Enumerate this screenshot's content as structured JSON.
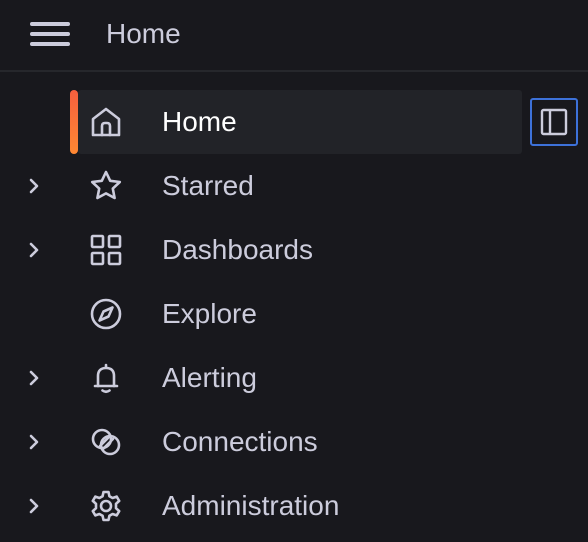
{
  "topbar": {
    "menu_icon": "hamburger-menu-icon",
    "breadcrumb": "Home"
  },
  "nav": {
    "items": [
      {
        "label": "Home",
        "icon": "home-icon",
        "active": true,
        "expandable": false
      },
      {
        "label": "Starred",
        "icon": "star-icon",
        "active": false,
        "expandable": true
      },
      {
        "label": "Dashboards",
        "icon": "apps-grid-icon",
        "active": false,
        "expandable": true
      },
      {
        "label": "Explore",
        "icon": "compass-icon",
        "active": false,
        "expandable": false
      },
      {
        "label": "Alerting",
        "icon": "bell-icon",
        "active": false,
        "expandable": true
      },
      {
        "label": "Connections",
        "icon": "connections-icon",
        "active": false,
        "expandable": true
      },
      {
        "label": "Administration",
        "icon": "cog-icon",
        "active": false,
        "expandable": true
      }
    ]
  },
  "dock_button": {
    "icon": "dock-menu-icon"
  },
  "colors": {
    "background": "#18181d",
    "active_background": "#222328",
    "text": "#ccccdc",
    "active_text": "#ffffff",
    "accent": "#ff7a3d",
    "focus": "#3d71d9"
  }
}
